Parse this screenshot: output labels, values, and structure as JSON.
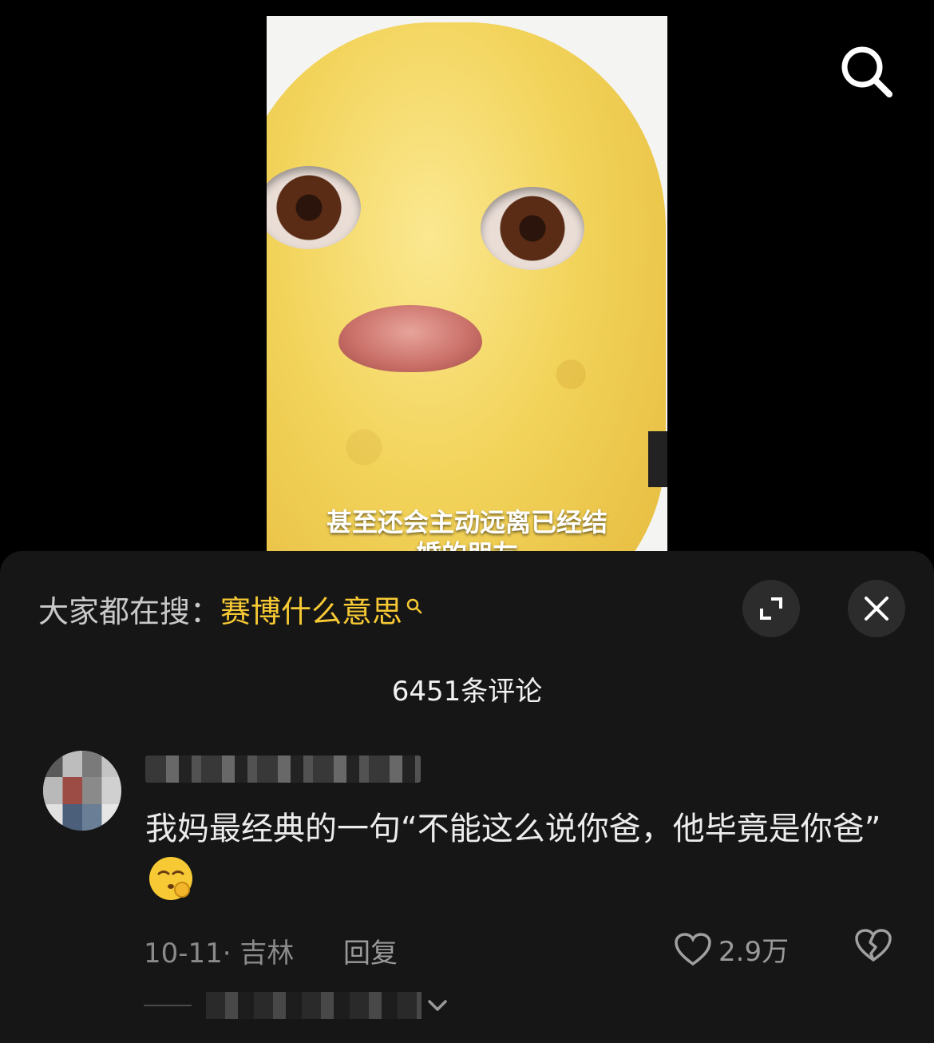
{
  "video": {
    "subtitle_line1": "甚至还会主动远离已经结",
    "subtitle_line2": "婚的朋友"
  },
  "header": {
    "search_icon": "search-icon"
  },
  "hot_search": {
    "prefix": "大家都在搜：",
    "query": "赛博什么意思"
  },
  "controls": {
    "expand_icon": "expand-icon",
    "close_icon": "close-icon"
  },
  "comments": {
    "count_label": "6451条评论",
    "items": [
      {
        "text": "我妈最经典的一句“不能这么说你爸，他毕竟是你爸”",
        "emoji": "face-emoji",
        "date_location": "10-11· 吉林",
        "reply_label": "回复",
        "likes": "2.9万"
      }
    ]
  },
  "colors": {
    "accent": "#f7c934",
    "sheet_bg": "#161616",
    "text_muted": "#8a8a8a"
  }
}
